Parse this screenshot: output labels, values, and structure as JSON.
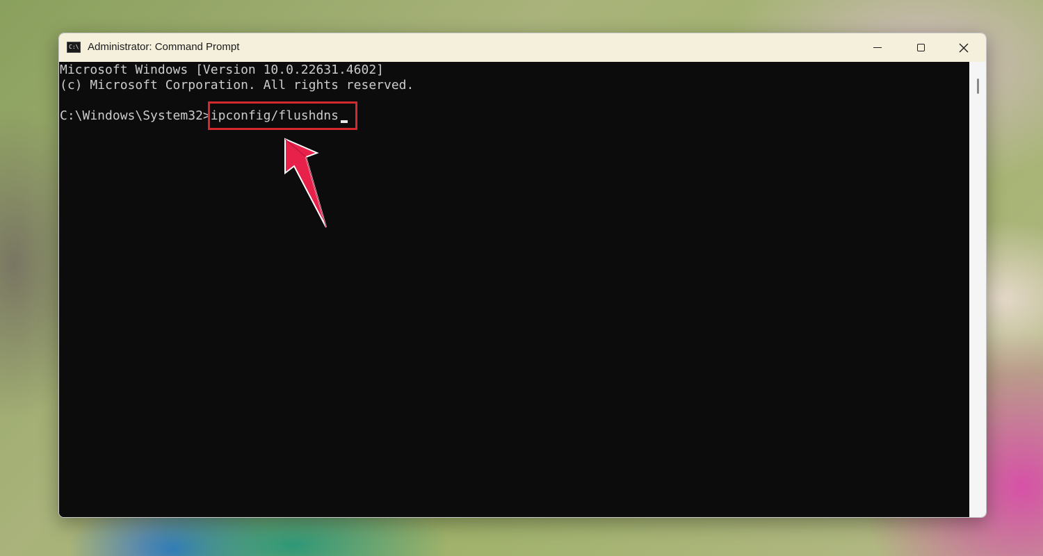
{
  "window": {
    "title": "Administrator: Command Prompt",
    "app_icon_text": "C:\\",
    "controls": {
      "minimize": "minimize-icon",
      "maximize": "maximize-icon",
      "close": "close-icon"
    }
  },
  "console": {
    "line1": "Microsoft Windows [Version 10.0.22631.4602]",
    "line2": "(c) Microsoft Corporation. All rights reserved.",
    "prompt": "C:\\Windows\\System32>",
    "command": "ipconfig/flushdns"
  },
  "colors": {
    "console_bg": "#0c0c0c",
    "console_text": "#cccccc",
    "highlight": "#d42a2f",
    "arrow": "#e8214a"
  }
}
